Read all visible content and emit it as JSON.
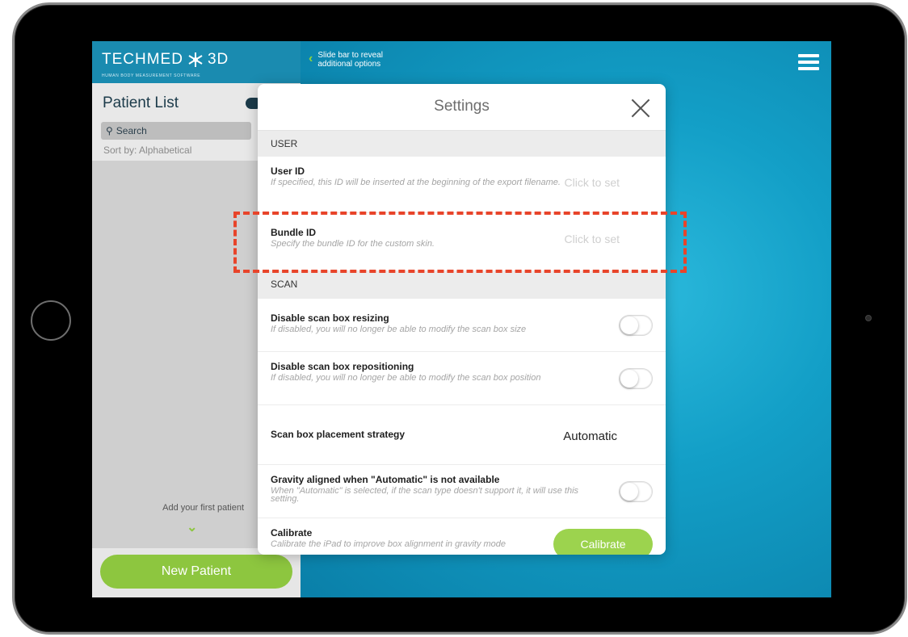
{
  "sidebar": {
    "logo_text": "TECHMED",
    "logo_suffix": "3D",
    "logo_subtitle": "HUMAN BODY MEASUREMENT SOFTWARE",
    "title": "Patient List",
    "search_placeholder": "Search",
    "sort_label": "Sort by: Alphabetical",
    "empty_hint": "Add your first patient",
    "new_patient_label": "New Patient"
  },
  "topbar": {
    "slide_hint_line1": "Slide bar to reveal",
    "slide_hint_line2": "additional options"
  },
  "settings": {
    "title": "Settings",
    "user_section": "USER",
    "user_id": {
      "title": "User ID",
      "desc": "If specified, this ID will be inserted at the beginning of the export filename.",
      "value": "Click to set"
    },
    "bundle_id": {
      "title": "Bundle ID",
      "desc": "Specify the bundle ID for the custom skin.",
      "value": "Click to set"
    },
    "scan_section": "SCAN",
    "disable_resizing": {
      "title": "Disable scan box resizing",
      "desc": "If disabled, you will no longer be able to modify the scan box size",
      "enabled": false
    },
    "disable_repositioning": {
      "title": "Disable scan box repositioning",
      "desc": "If disabled, you will no longer be able to modify the scan box position",
      "enabled": false
    },
    "placement_strategy": {
      "title": "Scan box placement strategy",
      "value": "Automatic"
    },
    "gravity_aligned": {
      "title": "Gravity aligned when \"Automatic\" is not available",
      "desc": "When \"Automatic\" is selected, if the scan type doesn't support it, it will use this setting.",
      "enabled": false
    },
    "calibrate": {
      "title": "Calibrate",
      "desc": "Calibrate the iPad to improve box alignment in gravity mode",
      "button_label": "Calibrate"
    }
  },
  "colors": {
    "accent_green": "#8dc63f",
    "highlight_red": "#e8442a",
    "brand_blue": "#1a8bb0"
  }
}
